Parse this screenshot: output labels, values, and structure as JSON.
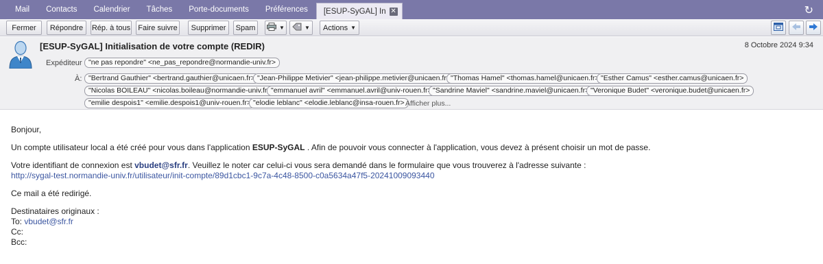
{
  "tabs": [
    "Mail",
    "Contacts",
    "Calendrier",
    "Tâches",
    "Porte-documents",
    "Préférences",
    "[ESUP-SyGAL] In"
  ],
  "toolbar": {
    "close": "Fermer",
    "reply": "Répondre",
    "reply_all": "Rép. à tous",
    "forward": "Faire suivre",
    "delete": "Supprimer",
    "spam": "Spam",
    "actions": "Actions"
  },
  "message": {
    "subject": "[ESUP-SyGAL] Initialisation de votre compte (REDIR)",
    "date": "8 Octobre 2024 9:34",
    "sender_label": "Expéditeur :",
    "sender": "\"ne pas repondre\" <ne_pas_repondre@normandie-univ.fr>",
    "to_label": "À:",
    "recipients": [
      "\"Bertrand Gauthier\" <bertrand.gauthier@unicaen.fr>",
      "\"Jean-Philippe Metivier\" <jean-philippe.metivier@unicaen.fr>",
      "\"Thomas Hamel\" <thomas.hamel@unicaen.fr>",
      "\"Esther Camus\" <esther.camus@unicaen.fr>",
      "\"Nicolas BOILEAU\" <nicolas.boileau@normandie-univ.fr>",
      "\"emmanuel avril\" <emmanuel.avril@univ-rouen.fr>",
      "\"Sandrine Maviel\" <sandrine.maviel@unicaen.fr>",
      "\"Veronique Budet\" <veronique.budet@unicaen.fr>",
      "\"emilie despois1\" <emilie.despois1@univ-rouen.fr>",
      "\"elodie leblanc\" <elodie.leblanc@insa-rouen.fr>"
    ],
    "show_more": "Afficher plus..."
  },
  "body": {
    "greeting": "Bonjour,",
    "p1_pre": "Un compte utilisateur local a été créé pour vous dans l'application ",
    "p1_app": "ESUP-SyGAL",
    "p1_post": " . Afin de pouvoir vous connecter à l'application, vous devez à présent choisir un mot de passe.",
    "p2_pre": "Votre identifiant de connexion est ",
    "p2_login": "vbudet@sfr.fr",
    "p2_post": ". Veuillez le noter car celui-ci vous sera demandé dans le formulaire que vous trouverez à l'adresse suivante :",
    "link": "http://sygal-test.normandie-univ.fr/utilisateur/init-compte/89d1cbc1-9c7a-4c48-8500-c0a5634a47f5-20241009093440",
    "redirect": "Ce mail a été redirigé.",
    "orig_label": "Destinataires originaux :",
    "to_label": "To: ",
    "to_value": "vbudet@sfr.fr",
    "cc_label": "Cc:",
    "bcc_label": "Bcc:"
  }
}
